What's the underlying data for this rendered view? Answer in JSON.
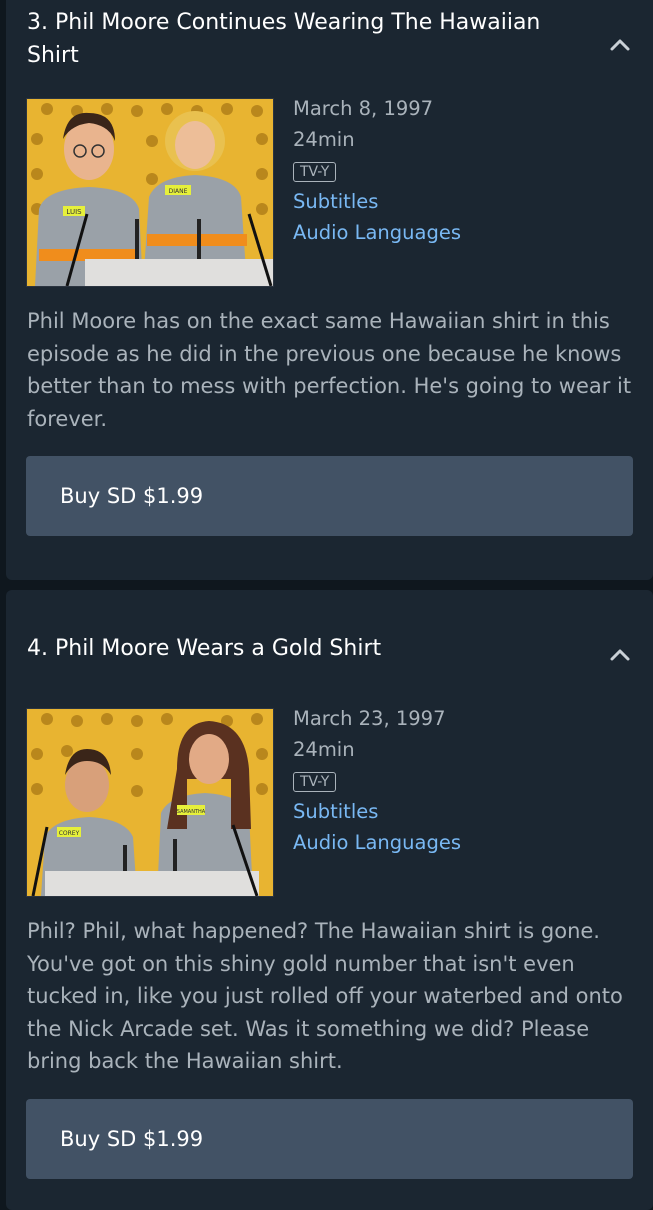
{
  "episodes": [
    {
      "title": "3. Phil Moore Continues Wearing The Hawaiian Shirt",
      "date": "March 8, 1997",
      "duration": "24min",
      "rating": "TV-Y",
      "subtitles_label": "Subtitles",
      "audio_label": "Audio Languages",
      "description": "Phil Moore has on the exact same Hawaiian shirt in this episode as he did in the previous one because he knows better than to mess with perfection. He's going to wear it forever.",
      "buy_label": "Buy SD $1.99",
      "thumbnail_name_tags": [
        "LUIS",
        "DIANE"
      ]
    },
    {
      "title": "4. Phil Moore Wears a Gold Shirt",
      "date": "March 23, 1997",
      "duration": "24min",
      "rating": "TV-Y",
      "subtitles_label": "Subtitles",
      "audio_label": "Audio Languages",
      "description": "Phil? Phil, what happened? The Hawaiian shirt is gone. You've got on this shiny gold number that isn't even tucked in, like you just rolled off your waterbed and onto the Nick Arcade set. Was it something we did? Please bring back the Hawaiian shirt.",
      "buy_label": "Buy SD $1.99",
      "thumbnail_name_tags": [
        "COREY",
        "SAMANTHA"
      ]
    }
  ],
  "icons": {
    "collapse": "chevron-up-icon"
  },
  "colors": {
    "background": "#0f171e",
    "card": "#1b2631",
    "button": "#425265",
    "link": "#79b8f3",
    "muted_text": "#aab3bb",
    "thumbnail_backdrop": "#e8b431"
  }
}
